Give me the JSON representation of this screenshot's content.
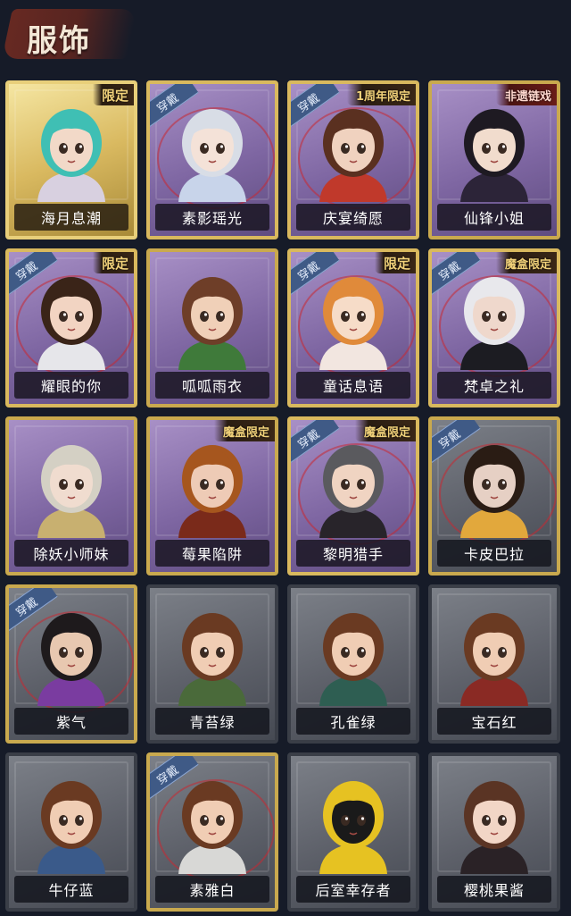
{
  "header": {
    "title": "服饰"
  },
  "worn_label": "穿戴",
  "items": [
    {
      "name": "海月息潮",
      "tag": "限定",
      "rarity": "gold",
      "worn": false,
      "skin": "#f2d9c8",
      "hair": "#3fbfb4",
      "outfit": "#d8d0e0"
    },
    {
      "name": "素影瑶光",
      "tag": "",
      "rarity": "purple",
      "worn": true,
      "skin": "#f4e2d8",
      "hair": "#d8dde6",
      "outfit": "#c8d4ea"
    },
    {
      "name": "庆宴绮愿",
      "tag": "1周年限定",
      "rarity": "purple",
      "worn": true,
      "skin": "#f0d2bf",
      "hair": "#5a3020",
      "outfit": "#c0392b"
    },
    {
      "name": "仙锋小姐",
      "tag": "非遗链戏",
      "rarity": "purple",
      "worn": false,
      "skin": "#f1dccd",
      "hair": "#1e1a22",
      "outfit": "#2c2438"
    },
    {
      "name": "耀眼的你",
      "tag": "限定",
      "rarity": "purple",
      "worn": true,
      "skin": "#f2d4c2",
      "hair": "#3a2418",
      "outfit": "#e6e6ea"
    },
    {
      "name": "呱呱雨衣",
      "tag": "",
      "rarity": "purple",
      "worn": false,
      "skin": "#f0d0b8",
      "hair": "#6e3e28",
      "outfit": "#3f7a3a"
    },
    {
      "name": "童话息语",
      "tag": "限定",
      "rarity": "purple",
      "worn": true,
      "skin": "#f6dcc8",
      "hair": "#e08a3a",
      "outfit": "#f2e6e0"
    },
    {
      "name": "梵卓之礼",
      "tag": "魔盒限定",
      "rarity": "purple",
      "worn": true,
      "skin": "#efd8cc",
      "hair": "#e8e8ec",
      "outfit": "#1c1c22"
    },
    {
      "name": "除妖小师妹",
      "tag": "",
      "rarity": "purple",
      "worn": false,
      "skin": "#f0dccf",
      "hair": "#d4d0c4",
      "outfit": "#c8b070"
    },
    {
      "name": "莓果陷阱",
      "tag": "魔盒限定",
      "rarity": "purple",
      "worn": false,
      "skin": "#eecbb6",
      "hair": "#a6561e",
      "outfit": "#7a2a1a"
    },
    {
      "name": "黎明猎手",
      "tag": "魔盒限定",
      "rarity": "purple",
      "worn": true,
      "skin": "#f0d4c2",
      "hair": "#5a5a5e",
      "outfit": "#28242a"
    },
    {
      "name": "卡皮巴拉",
      "tag": "",
      "rarity": "gray",
      "worn": true,
      "skin": "#e6d0c4",
      "hair": "#2a1c14",
      "outfit": "#e2a83c"
    },
    {
      "name": "紫气",
      "tag": "",
      "rarity": "gray",
      "worn": true,
      "skin": "#e8c8b0",
      "hair": "#1e1a1c",
      "outfit": "#7a3ca0"
    },
    {
      "name": "青苔绿",
      "tag": "",
      "rarity": "gray",
      "worn": false,
      "skin": "#f0cdb4",
      "hair": "#6a3a22",
      "outfit": "#4a6a3a"
    },
    {
      "name": "孔雀绿",
      "tag": "",
      "rarity": "gray",
      "worn": false,
      "skin": "#f0cdb4",
      "hair": "#6a3a22",
      "outfit": "#2e5e52"
    },
    {
      "name": "宝石红",
      "tag": "",
      "rarity": "gray",
      "worn": false,
      "skin": "#f0cdb4",
      "hair": "#6a3a22",
      "outfit": "#8a2a24"
    },
    {
      "name": "牛仔蓝",
      "tag": "",
      "rarity": "gray",
      "worn": false,
      "skin": "#f0cdb4",
      "hair": "#6a3a22",
      "outfit": "#3a5a8a"
    },
    {
      "name": "素雅白",
      "tag": "",
      "rarity": "gray",
      "worn": true,
      "skin": "#f0cdb4",
      "hair": "#6a3a22",
      "outfit": "#d8d8d6"
    },
    {
      "name": "后室幸存者",
      "tag": "",
      "rarity": "gray",
      "worn": false,
      "skin": "#1a1a1a",
      "hair": "#e6c222",
      "outfit": "#e6c222"
    },
    {
      "name": "樱桃果酱",
      "tag": "",
      "rarity": "gray",
      "worn": false,
      "skin": "#f2d6c6",
      "hair": "#5a3424",
      "outfit": "#2a2226"
    }
  ]
}
